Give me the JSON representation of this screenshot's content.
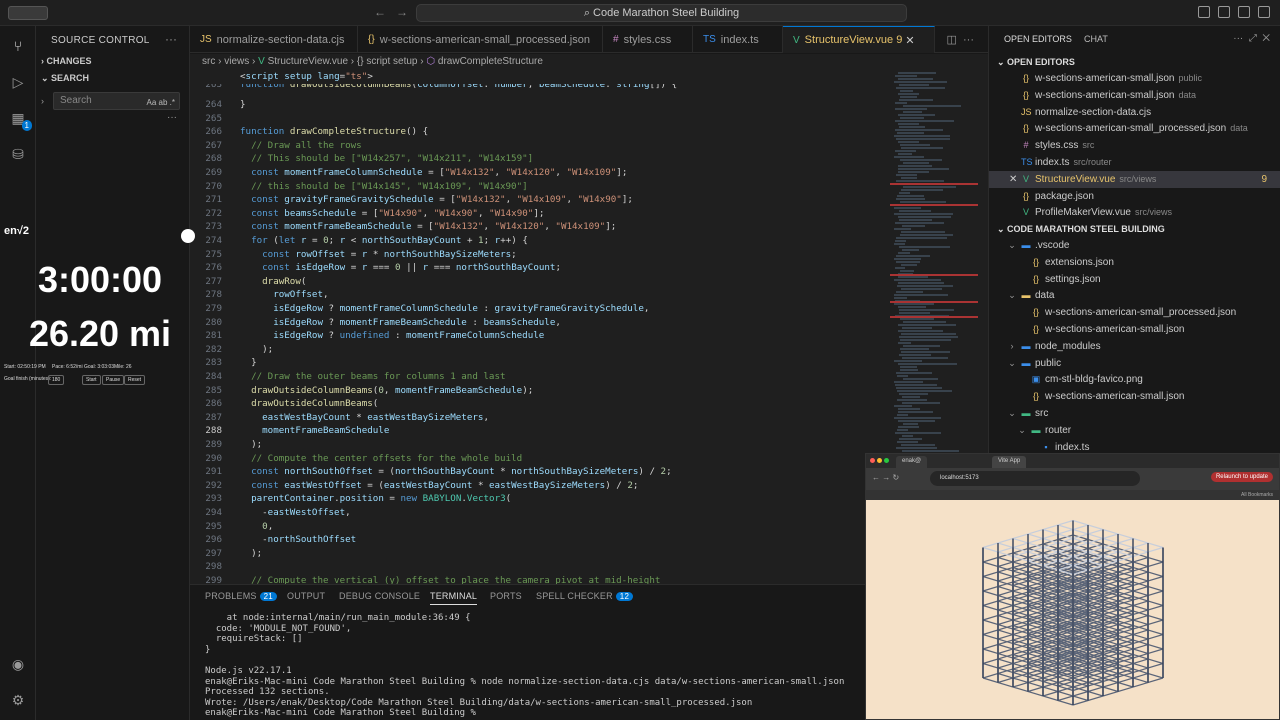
{
  "titlebar": {
    "search": "Code Marathon Steel Building",
    "back": "←",
    "forward": "→"
  },
  "activity": {
    "badge_ext": "1"
  },
  "overlay": {
    "label": "en√2",
    "time": "3:00:00",
    "distance": "26.20 mi",
    "stats": [
      "Start: 02:50:19 PM",
      "Pace: 6:52/mi",
      "Goal: 3:03:03",
      "Mile: 26"
    ],
    "goal": "Goal finish (minutes):",
    "goal_val": "180",
    "buttons": [
      "Start",
      "Pause",
      "Reset"
    ]
  },
  "sidebar": {
    "title": "SOURCE CONTROL",
    "changes": "CHANGES",
    "search_sec": "SEARCH",
    "search_placeholder": "Search",
    "search_opts": "Aa ab .*"
  },
  "tabs": [
    {
      "label": "normalize-section-data.cjs",
      "icon": "JS"
    },
    {
      "label": "w-sections-american-small_processed.json",
      "icon": "{}"
    },
    {
      "label": "styles.css",
      "icon": "#"
    },
    {
      "label": "index.ts",
      "icon": "TS"
    },
    {
      "label": "StructureView.vue",
      "icon": "V",
      "badge": "9"
    }
  ],
  "breadcrumb": [
    "src",
    "views",
    "StructureView.vue",
    "{} script setup",
    "drawCompleteStructure"
  ],
  "code_lines": [
    {
      "n": "",
      "t": "<script setup lang=\"ts\">"
    },
    {
      "n": "263",
      "t": "function drawOutsideColumnBeams(columnOffset: number, beamSchedule: string[]) {"
    },
    {
      "n": "264",
      "t": "}"
    },
    {
      "n": "265",
      "t": ""
    },
    {
      "n": "266",
      "t": "function drawCompleteStructure() {"
    },
    {
      "n": "267",
      "t": "  // Draw all the rows"
    },
    {
      "n": "268",
      "t": "  // This should be [\"W14x257\", \"W14x211\", \"W14x159\"]"
    },
    {
      "n": "269",
      "t": "  const momentFrameColumnSchedule = [\"W14x132\", \"W14x120\", \"W14x109\"];"
    },
    {
      "n": "270",
      "t": "  // this should be [\"W14x145\", \"W14x109\", \"W14x90\"]"
    },
    {
      "n": "271",
      "t": "  const gravityFrameGravitySchedule = [\"W14x132\", \"W14x109\", \"W14x90\"];"
    },
    {
      "n": "272",
      "t": "  const beamsSchedule = [\"W14x90\", \"W14x90\", \"W14x90\"];"
    },
    {
      "n": "273",
      "t": "  const momentFrameBeamSchedule = [\"W14x132\", \"W14x120\", \"W14x109\"];"
    },
    {
      "n": "274",
      "t": "  for (let r = 0; r < northSouthBayCount + 1; r++) {"
    },
    {
      "n": "275",
      "t": "    const rowOffset = r * northSouthBaySizeMeters;"
    },
    {
      "n": "276",
      "t": "    const isEdgeRow = r === 0 || r === northSouthBayCount;"
    },
    {
      "n": "277",
      "t": "    drawRow("
    },
    {
      "n": "278",
      "t": "      rowOffset,"
    },
    {
      "n": "279",
      "t": "      isEdgeRow ? momentFrameColumnSchedule : gravityFrameGravitySchedule,"
    },
    {
      "n": "280",
      "t": "      isEdgeRow ? momentFrameBeamSchedule : beamsSchedule,"
    },
    {
      "n": "281",
      "t": "      isEdgeRow ? undefined : momentFrameColumnSchedule"
    },
    {
      "n": "282",
      "t": "    );"
    },
    {
      "n": "283",
      "t": "  }"
    },
    {
      "n": "284",
      "t": "  // Draw the outer beams for columns 1 and last"
    },
    {
      "n": "285",
      "t": "  drawOutsideColumnBeams(0, momentFrameBeamSchedule);"
    },
    {
      "n": "286",
      "t": "  drawOutsideColumnBeams("
    },
    {
      "n": "287",
      "t": "    eastWestBayCount * eastWestBaySizeMeters,"
    },
    {
      "n": "288",
      "t": "    momentFrameBeamSchedule"
    },
    {
      "n": "289",
      "t": "  );"
    },
    {
      "n": "290",
      "t": "  // Compute the center offsets for the whole build"
    },
    {
      "n": "291",
      "t": "  const northSouthOffset = (northSouthBayCount * northSouthBaySizeMeters) / 2;"
    },
    {
      "n": "292",
      "t": "  const eastWestOffset = (eastWestBayCount * eastWestBaySizeMeters) / 2;"
    },
    {
      "n": "293",
      "t": "  parentContainer.position = new BABYLON.Vector3("
    },
    {
      "n": "294",
      "t": "    -eastWestOffset,"
    },
    {
      "n": "295",
      "t": "    0,"
    },
    {
      "n": "296",
      "t": "    -northSouthOffset"
    },
    {
      "n": "297",
      "t": "  );"
    },
    {
      "n": "298",
      "t": ""
    },
    {
      "n": "299",
      "t": "  // Compute the vertical (y) offset to place the camera pivot at mid-height"
    }
  ],
  "current_line": "288",
  "panel": {
    "tabs": [
      {
        "label": "PROBLEMS",
        "badge": "21"
      },
      {
        "label": "OUTPUT"
      },
      {
        "label": "DEBUG CONSOLE"
      },
      {
        "label": "TERMINAL"
      },
      {
        "label": "PORTS"
      },
      {
        "label": "SPELL CHECKER",
        "badge": "12"
      }
    ],
    "terminal": "    at node:internal/main/run_main_module:36:49 {\n  code: 'MODULE_NOT_FOUND',\n  requireStack: []\n}\n\nNode.js v22.17.1\nenak@Eriks-Mac-mini Code Marathon Steel Building % node normalize-section-data.cjs data/w-sections-american-small.json\nProcessed 132 sections.\nWrote: /Users/enak/Desktop/Code Marathon Steel Building/data/w-sections-american-small_processed.json\nenak@Eriks-Mac-mini Code Marathon Steel Building % "
  },
  "right": {
    "tabs": [
      "OPEN EDITORS",
      "CHAT"
    ],
    "open_editors_head": "OPEN EDITORS",
    "open_editors": [
      {
        "name": "w-sections-american-small.json",
        "dim": "public",
        "icon": "{}"
      },
      {
        "name": "w-sections-american-small.json",
        "dim": "data",
        "icon": "{}"
      },
      {
        "name": "normalize-section-data.cjs",
        "dim": "",
        "icon": "JS"
      },
      {
        "name": "w-sections-american-small_processed.json",
        "dim": "data",
        "icon": "{}"
      },
      {
        "name": "styles.css",
        "dim": "src",
        "icon": "#"
      },
      {
        "name": "index.ts",
        "dim": "src/router",
        "icon": "TS"
      },
      {
        "name": "StructureView.vue",
        "dim": "src/views",
        "icon": "V",
        "badge": "9"
      },
      {
        "name": "package.json",
        "dim": "",
        "icon": "{}"
      },
      {
        "name": "ProfileMakerView.vue",
        "dim": "src/views",
        "icon": "V"
      }
    ],
    "project_head": "CODE MARATHON STEEL BUILDING",
    "tree": [
      {
        "name": ".vscode",
        "depth": 1,
        "folder": true
      },
      {
        "name": "extensions.json",
        "depth": 2
      },
      {
        "name": "settings.json",
        "depth": 2
      },
      {
        "name": "data",
        "depth": 1,
        "folder": true
      },
      {
        "name": "w-sections-american-small_processed.json",
        "depth": 2
      },
      {
        "name": "w-sections-american-small.json",
        "depth": 2
      },
      {
        "name": "node_modules",
        "depth": 1,
        "folder": true,
        "closed": true
      },
      {
        "name": "public",
        "depth": 1,
        "folder": true
      },
      {
        "name": "cm-stl-bldg-favico.png",
        "depth": 2
      },
      {
        "name": "w-sections-american-small.json",
        "depth": 2
      },
      {
        "name": "src",
        "depth": 1,
        "folder": true
      },
      {
        "name": "router",
        "depth": 2,
        "folder": true
      },
      {
        "name": "index.ts",
        "depth": 3
      }
    ]
  },
  "browser": {
    "tab1": "enak@",
    "tab2": "Vite App",
    "url": "localhost:5173",
    "update": "Relaunch to update",
    "bookmarks": "All Bookmarks"
  }
}
